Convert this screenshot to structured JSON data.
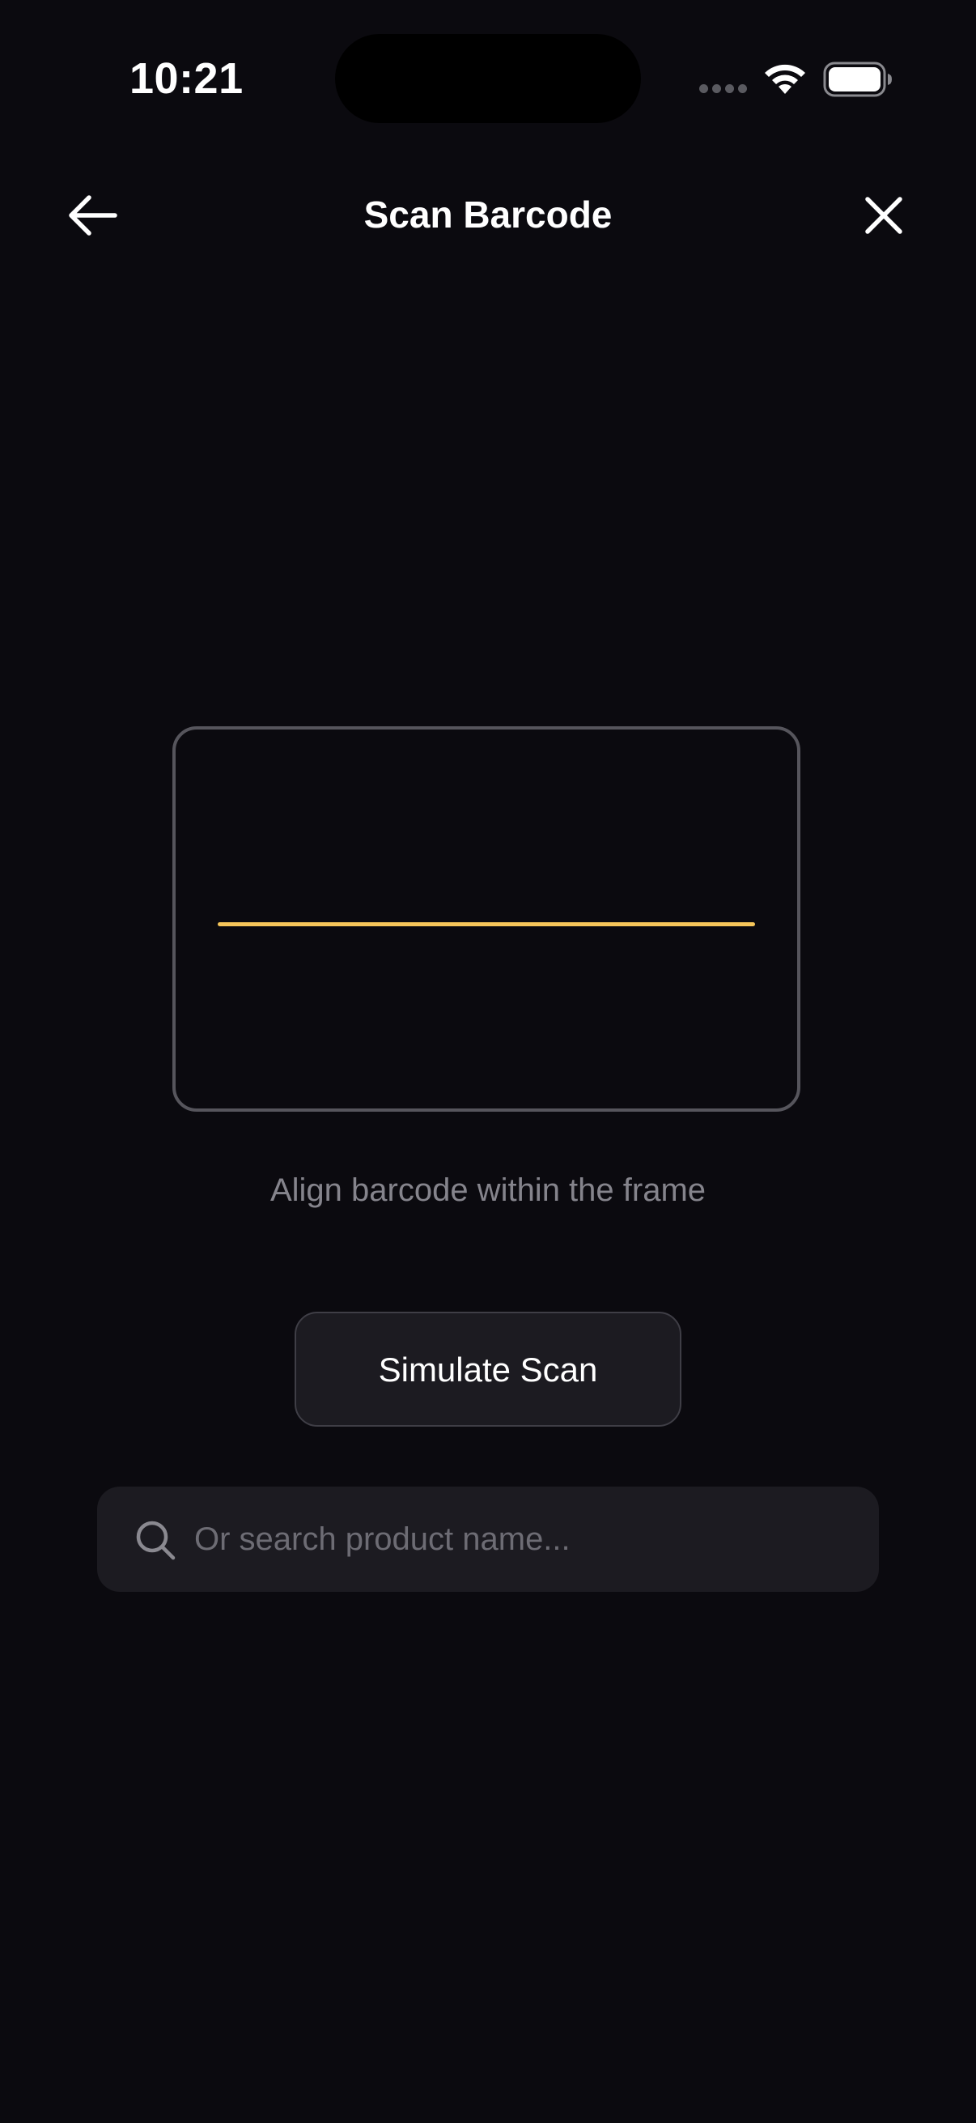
{
  "status_bar": {
    "time": "10:21"
  },
  "header": {
    "title": "Scan Barcode",
    "back_icon": "arrow-left-icon",
    "close_icon": "close-icon"
  },
  "scanner": {
    "hint": "Align barcode within the frame",
    "scan_line_color": "#f6c65a"
  },
  "actions": {
    "simulate_label": "Simulate Scan"
  },
  "search": {
    "placeholder": "Or search product name...",
    "value": "",
    "icon": "search-icon"
  },
  "colors": {
    "background": "#0b0a0f",
    "surface": "#1c1b21",
    "accent": "#f6c65a"
  }
}
